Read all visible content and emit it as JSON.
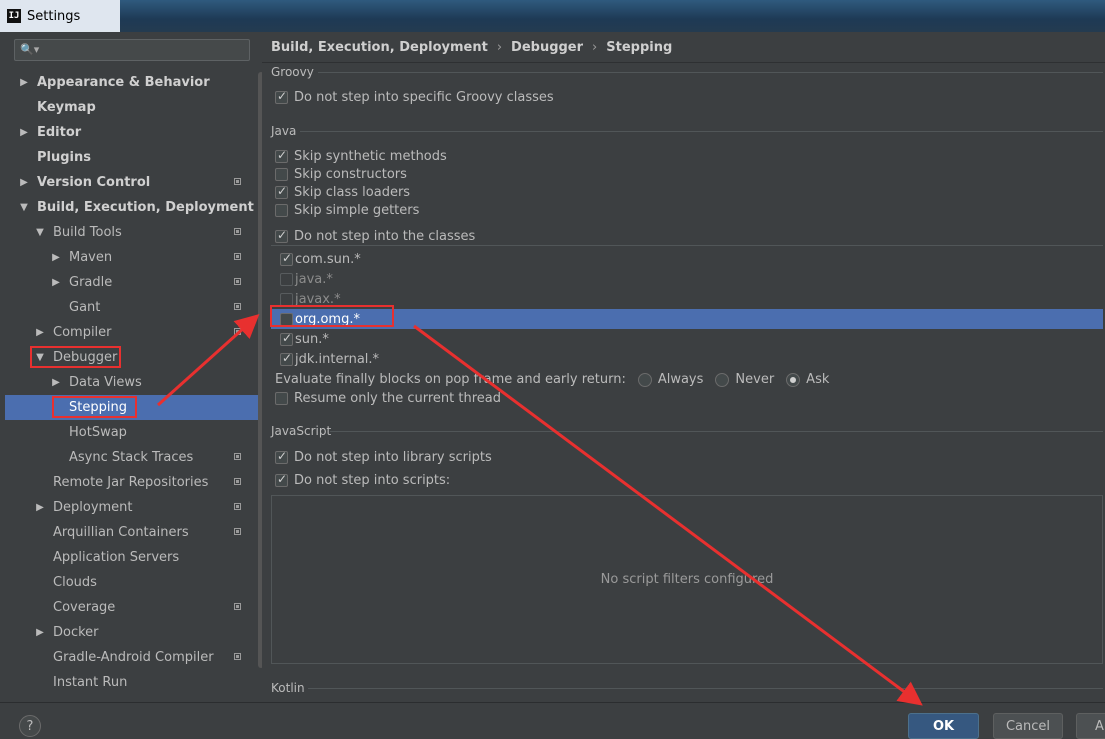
{
  "window": {
    "title": "Settings",
    "logo": "IJ"
  },
  "search": {
    "placeholder": "",
    "icon": "search-icon"
  },
  "tree": [
    {
      "label": "Appearance & Behavior",
      "bold": true,
      "arrow": "right",
      "level": 0,
      "copy": false
    },
    {
      "label": "Keymap",
      "bold": true,
      "arrow": "",
      "level": 0,
      "copy": false
    },
    {
      "label": "Editor",
      "bold": true,
      "arrow": "right",
      "level": 0,
      "copy": false
    },
    {
      "label": "Plugins",
      "bold": true,
      "arrow": "",
      "level": 0,
      "copy": false
    },
    {
      "label": "Version Control",
      "bold": true,
      "arrow": "right",
      "level": 0,
      "copy": true
    },
    {
      "label": "Build, Execution, Deployment",
      "bold": true,
      "arrow": "down",
      "level": 0,
      "copy": false
    },
    {
      "label": "Build Tools",
      "bold": false,
      "arrow": "down",
      "level": 1,
      "copy": true
    },
    {
      "label": "Maven",
      "bold": false,
      "arrow": "right",
      "level": 2,
      "copy": true
    },
    {
      "label": "Gradle",
      "bold": false,
      "arrow": "right",
      "level": 2,
      "copy": true
    },
    {
      "label": "Gant",
      "bold": false,
      "arrow": "",
      "level": 2,
      "copy": true
    },
    {
      "label": "Compiler",
      "bold": false,
      "arrow": "right",
      "level": 1,
      "copy": true
    },
    {
      "label": "Debugger",
      "bold": false,
      "arrow": "down",
      "level": 1,
      "copy": false
    },
    {
      "label": "Data Views",
      "bold": false,
      "arrow": "right",
      "level": 2,
      "copy": false
    },
    {
      "label": "Stepping",
      "bold": false,
      "arrow": "",
      "level": 2,
      "copy": false,
      "selected": true
    },
    {
      "label": "HotSwap",
      "bold": false,
      "arrow": "",
      "level": 2,
      "copy": false
    },
    {
      "label": "Async Stack Traces",
      "bold": false,
      "arrow": "",
      "level": 2,
      "copy": true
    },
    {
      "label": "Remote Jar Repositories",
      "bold": false,
      "arrow": "",
      "level": 1,
      "copy": true
    },
    {
      "label": "Deployment",
      "bold": false,
      "arrow": "right",
      "level": 1,
      "copy": true
    },
    {
      "label": "Arquillian Containers",
      "bold": false,
      "arrow": "",
      "level": 1,
      "copy": true
    },
    {
      "label": "Application Servers",
      "bold": false,
      "arrow": "",
      "level": 1,
      "copy": false
    },
    {
      "label": "Clouds",
      "bold": false,
      "arrow": "",
      "level": 1,
      "copy": false
    },
    {
      "label": "Coverage",
      "bold": false,
      "arrow": "",
      "level": 1,
      "copy": true
    },
    {
      "label": "Docker",
      "bold": false,
      "arrow": "right",
      "level": 1,
      "copy": false
    },
    {
      "label": "Gradle-Android Compiler",
      "bold": false,
      "arrow": "",
      "level": 1,
      "copy": true
    },
    {
      "label": "Instant Run",
      "bold": false,
      "arrow": "",
      "level": 1,
      "copy": false
    }
  ],
  "breadcrumb": [
    "Build, Execution, Deployment",
    "Debugger",
    "Stepping"
  ],
  "groovy": {
    "title": "Groovy",
    "option": {
      "label": "Do not step into specific Groovy classes",
      "checked": true
    }
  },
  "java": {
    "title": "Java",
    "options": [
      {
        "label": "Skip synthetic methods",
        "checked": true
      },
      {
        "label": "Skip constructors",
        "checked": false
      },
      {
        "label": "Skip class loaders",
        "checked": true
      },
      {
        "label": "Skip simple getters",
        "checked": false
      }
    ],
    "classes_option": {
      "label": "Do not step into the classes",
      "checked": true
    },
    "classes": [
      {
        "name": "com.sun.*",
        "checked": true,
        "dim": false
      },
      {
        "name": "java.*",
        "checked": false,
        "dim": true
      },
      {
        "name": "javax.*",
        "checked": false,
        "dim": true
      },
      {
        "name": "org.omg.*",
        "checked": false,
        "dim": false,
        "selected": true
      },
      {
        "name": "sun.*",
        "checked": true,
        "dim": false
      },
      {
        "name": "jdk.internal.*",
        "checked": true,
        "dim": false
      }
    ],
    "evaluate_label": "Evaluate finally blocks on pop frame and early return:",
    "evaluate_options": [
      {
        "label": "Always",
        "selected": false
      },
      {
        "label": "Never",
        "selected": false
      },
      {
        "label": "Ask",
        "selected": true
      }
    ],
    "resume_option": {
      "label": "Resume only the current thread",
      "checked": false
    }
  },
  "javascript": {
    "title": "JavaScript",
    "options": [
      {
        "label": "Do not step into library scripts",
        "checked": true
      },
      {
        "label": "Do not step into scripts:",
        "checked": true
      }
    ],
    "empty_text": "No script filters configured"
  },
  "kotlin": {
    "title": "Kotlin"
  },
  "footer": {
    "help": "?",
    "ok": "OK",
    "cancel": "Cancel",
    "apply": "A"
  },
  "colors": {
    "selection": "#4b6eaf",
    "annotation": "#e8302f",
    "background": "#3c3f41"
  }
}
